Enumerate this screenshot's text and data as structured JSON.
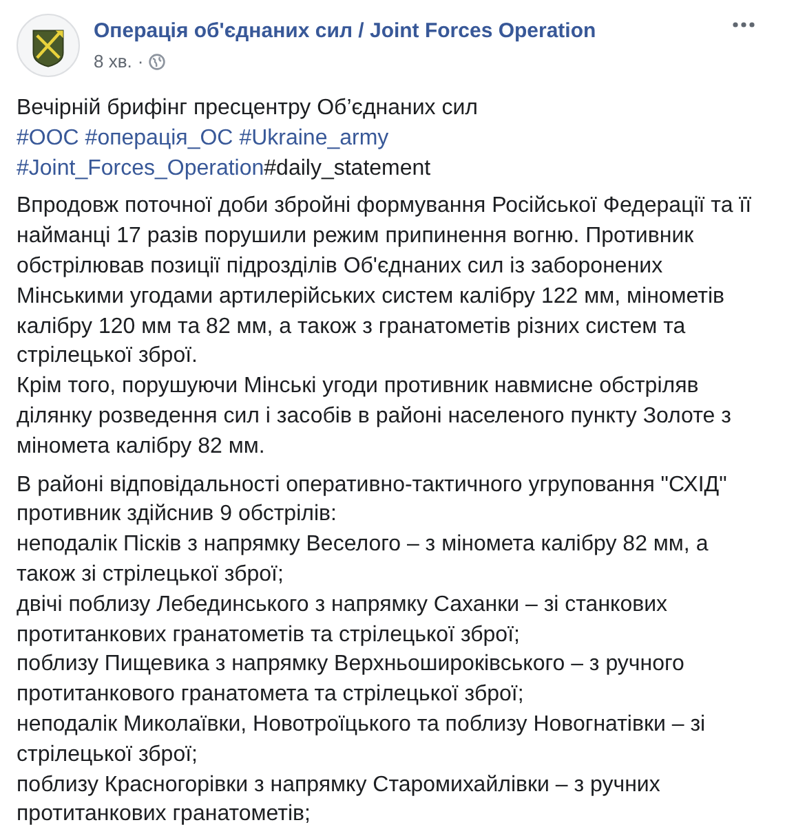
{
  "post": {
    "page_name": "Операція об'єднаних сил / Joint Forces Operation",
    "time": "8 хв.",
    "separator": "·",
    "intro": "Вечірній брифінг пресцентру Об’єднаних сил",
    "hashtags": [
      {
        "text": "#ООС",
        "link": true
      },
      {
        "text": "#операція_ОС",
        "link": true
      },
      {
        "text": "#Ukraine_army",
        "link": true
      },
      {
        "text": "#Joint_Forces_Operation",
        "link": true
      },
      {
        "text": "#daily_statement",
        "link": false
      }
    ],
    "paragraphs": [
      [
        "Впродовж поточної доби збройні формування Російської Федерації та її найманці 17 разів порушили режим припинення вогню. Противник обстрілював позиції підрозділів Об'єднаних сил із заборонених Мінськими угодами артилерійських систем калібру 122 мм, мінометів калібру 120 мм та 82 мм, а також з гранатометів різних систем та стрілецької зброї.",
        "Крім того, порушуючи Мінські угоди противник навмисне обстріляв ділянку розведення сил і засобів в районі населеного пункту Золоте з міномета калібру 82 мм."
      ],
      [
        "В районі відповідальності оперативно-тактичного угруповання \"СХІД\" противник здійснив 9 обстрілів:",
        "неподалік Пісків з напрямку Веселого – з міномета калібру 82 мм, а також зі стрілецької зброї;",
        "двічі поблизу Лебединського з напрямку Саханки – зі станкових протитанкових гранатометів та стрілецької зброї;",
        "поблизу Пищевика з напрямку Верхньошироківського – з ручного протитанкового гранатомета та стрілецької зброї;",
        "неподалік Миколаївки, Новотроїцького та поблизу Новогнатівки – зі стрілецької зброї;",
        "поблизу Красногорівки з напрямку Старомихайлівки – з ручних протитанкових гранатометів;"
      ]
    ]
  }
}
